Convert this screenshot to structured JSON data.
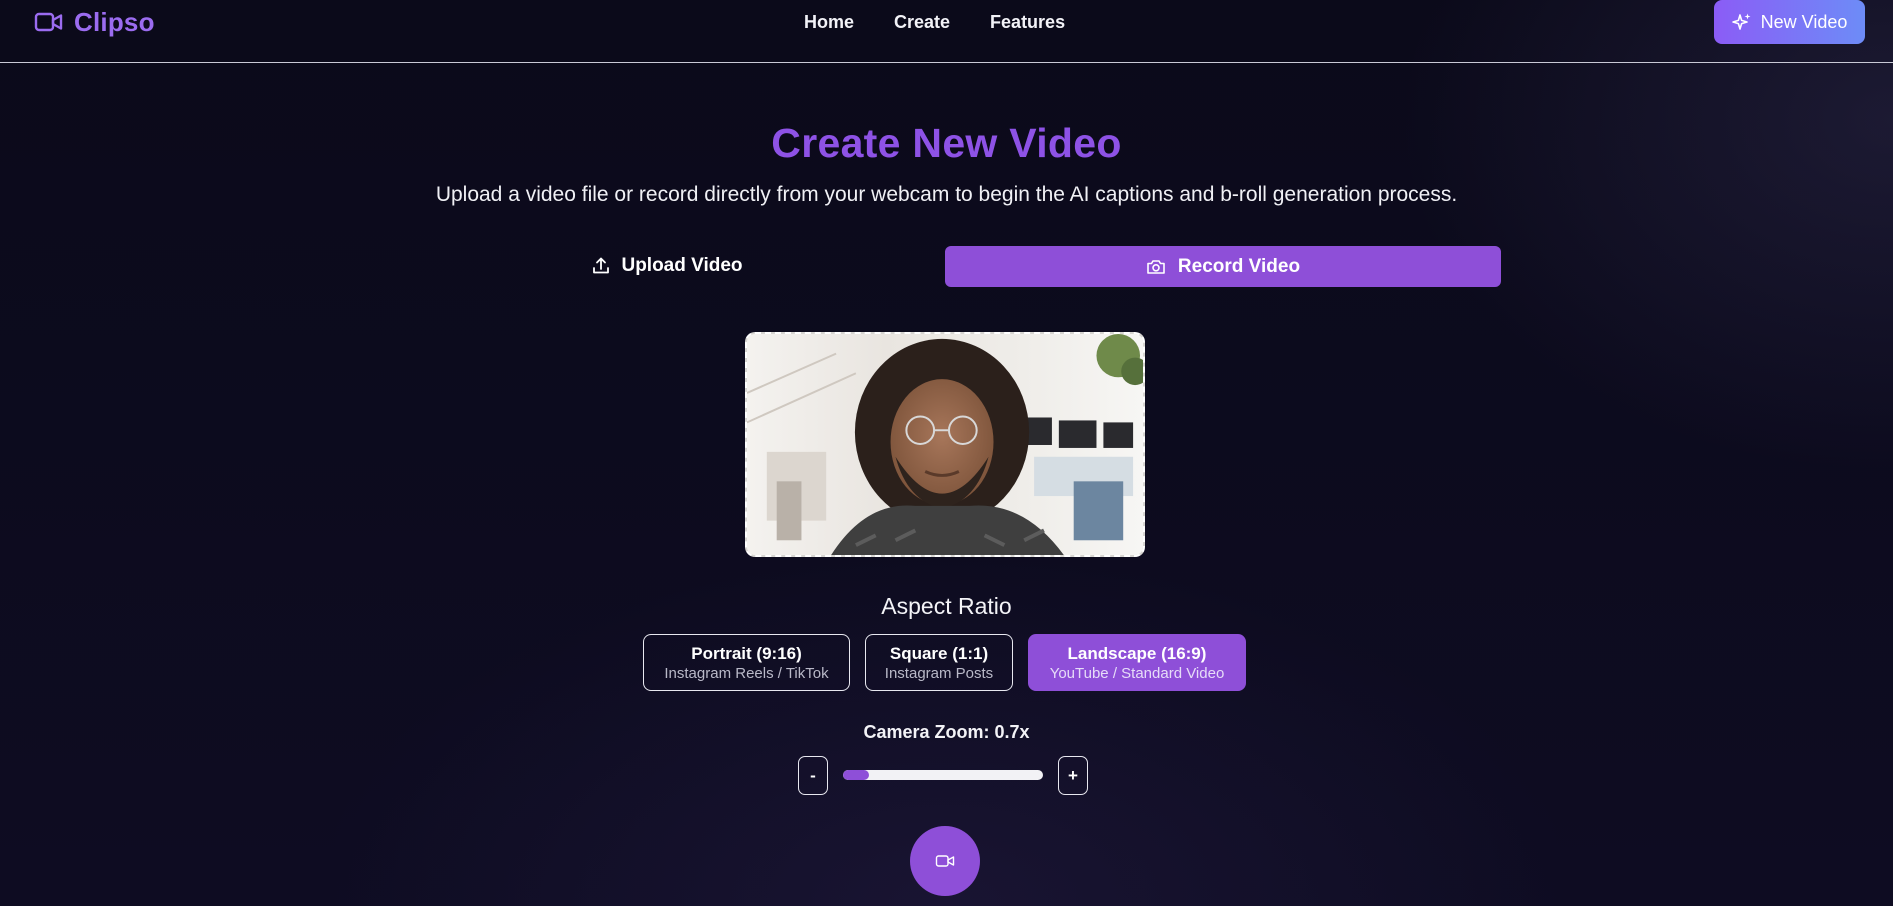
{
  "nav": {
    "brand": "Clipso",
    "brand_icon": "video-camera-icon",
    "links": [
      {
        "label": "Home"
      },
      {
        "label": "Create"
      },
      {
        "label": "Features"
      }
    ],
    "new_video": {
      "label": "New Video",
      "icon": "sparkles-icon"
    }
  },
  "header": {
    "title": "Create New Video",
    "subtitle": "Upload a video file or record directly from your webcam to begin the AI captions and b-roll generation process."
  },
  "mode_toggle": {
    "upload": {
      "label": "Upload Video",
      "icon": "upload-icon"
    },
    "record": {
      "label": "Record Video",
      "icon": "camera-icon",
      "active": true
    }
  },
  "preview": {
    "content": "webcam-feed"
  },
  "aspect_ratio": {
    "title": "Aspect Ratio",
    "options": [
      {
        "name": "Portrait (9:16)",
        "desc": "Instagram Reels / TikTok",
        "active": false
      },
      {
        "name": "Square (1:1)",
        "desc": "Instagram Posts",
        "active": false
      },
      {
        "name": "Landscape (16:9)",
        "desc": "YouTube / Standard Video",
        "active": true
      }
    ]
  },
  "zoom": {
    "label": "Camera Zoom: 0.7x",
    "decrease": "-",
    "increase": "+",
    "level_fraction": 0.13
  },
  "record_button": {
    "icon": "video-camera-icon"
  },
  "colors": {
    "accent": "#8e4fd8",
    "title": "#8e52e6",
    "brand": "#9b6cf0",
    "background": "#0c0b1d"
  }
}
